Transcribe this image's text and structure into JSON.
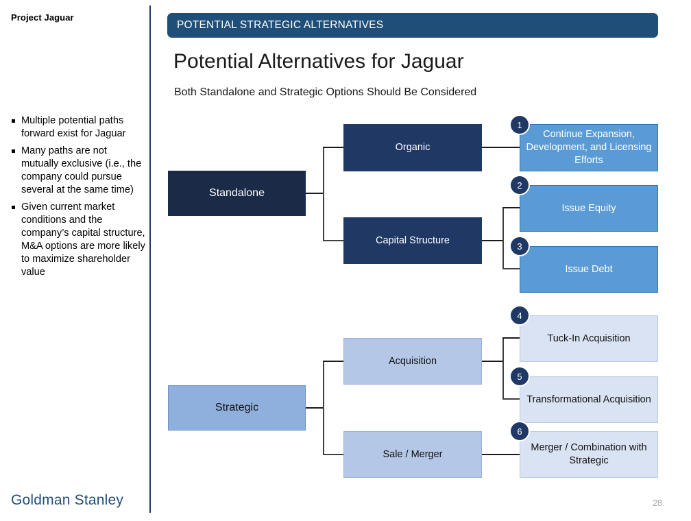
{
  "sidebar": {
    "project_label": "Project Jaguar",
    "bullets": [
      "Multiple potential paths forward exist for Jaguar",
      "Many paths are not mutually exclusive (i.e., the company could pursue several at the same time)",
      "Given current market conditions and the company’s capital structure, M&A options are more likely to maximize shareholder value"
    ],
    "brand": "Goldman Stanley"
  },
  "header": {
    "banner_label": "POTENTIAL STRATEGIC ALTERNATIVES",
    "title": "Potential Alternatives for Jaguar",
    "subtitle": "Both Standalone and Strategic Options Should Be Considered"
  },
  "footer": {
    "page_number": "28"
  },
  "colors": {
    "banner": "#1F4E79",
    "navy_dark": "#1B2A47",
    "navy": "#1F3864",
    "blue_mid": "#5B9BD5",
    "blue_soft": "#8FAFDC",
    "blue_pale": "#B4C7E7",
    "blue_faint": "#DAE3F3",
    "divider": "#1F3864",
    "page_number": "#A6A6A6"
  },
  "diagram": {
    "level1": [
      {
        "label": "Standalone"
      },
      {
        "label": "Strategic"
      }
    ],
    "level2": [
      {
        "label": "Organic"
      },
      {
        "label": "Capital Structure"
      },
      {
        "label": "Acquisition"
      },
      {
        "label": "Sale / Merger"
      }
    ],
    "level3": [
      {
        "number": "1",
        "label": "Continue Expansion, Development, and Licensing Efforts"
      },
      {
        "number": "2",
        "label": "Issue Equity"
      },
      {
        "number": "3",
        "label": "Issue Debt"
      },
      {
        "number": "4",
        "label": "Tuck-In Acquisition"
      },
      {
        "number": "5",
        "label": "Transformational Acquisition"
      },
      {
        "number": "6",
        "label": "Merger / Combination with Strategic"
      }
    ]
  }
}
